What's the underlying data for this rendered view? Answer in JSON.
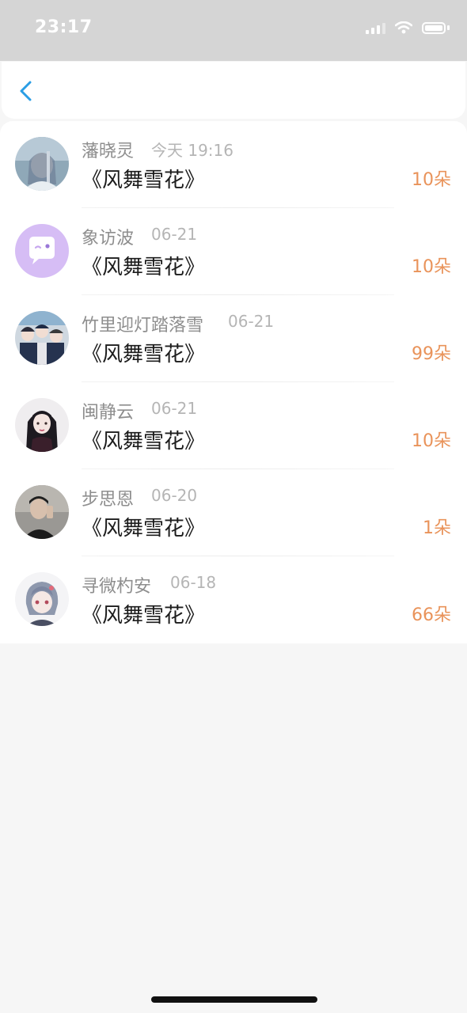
{
  "status_bar": {
    "time": "23:17"
  },
  "colors": {
    "accent_blue": "#2a9ee5",
    "amount_orange": "#e9935a"
  },
  "icons": {
    "back": "chevron-left-icon"
  },
  "gifts": [
    {
      "name": "藩晓灵",
      "date": "今天 19:16",
      "gift": "《风舞雪花》",
      "amount": "10朵"
    },
    {
      "name": "象访波",
      "date": "06-21",
      "gift": "《风舞雪花》",
      "amount": "10朵"
    },
    {
      "name": "竹里迎灯踏落雪",
      "date": "06-21",
      "gift": "《风舞雪花》",
      "amount": "99朵"
    },
    {
      "name": "闽静云",
      "date": "06-21",
      "gift": "《风舞雪花》",
      "amount": "10朵"
    },
    {
      "name": "步思恩",
      "date": "06-20",
      "gift": "《风舞雪花》",
      "amount": "1朵"
    },
    {
      "name": "寻微杓安",
      "date": "06-18",
      "gift": "《风舞雪花》",
      "amount": "66朵"
    }
  ]
}
